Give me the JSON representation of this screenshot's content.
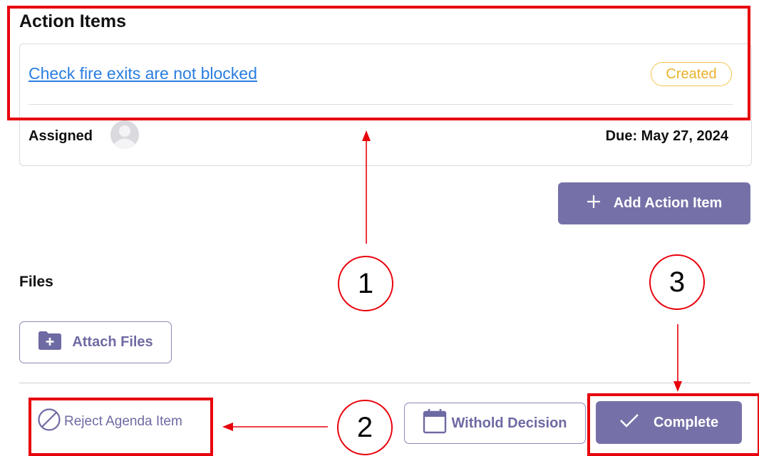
{
  "action_items": {
    "title": "Action Items",
    "item": {
      "link": "Check fire exits are not blocked",
      "status": "Created",
      "assigned_label": "Assigned",
      "due": "Due: May 27, 2024"
    },
    "add_button": "Add Action Item"
  },
  "files": {
    "title": "Files",
    "attach_button": "Attach Files"
  },
  "footer": {
    "reject": "Reject Agenda Item",
    "withold": "Withold Decision",
    "complete": "Complete"
  },
  "callouts": [
    "1",
    "2",
    "3"
  ],
  "colors": {
    "accent": "#7571a8",
    "link": "#2a7de1",
    "status_created": "#f3c34a",
    "annotation": "#e8000b"
  },
  "icons": {
    "avatar": "user-avatar-icon",
    "add": "plus-icon",
    "attach": "folder-plus-icon",
    "reject": "block-icon",
    "withold": "calendar-icon",
    "complete": "check-icon"
  }
}
